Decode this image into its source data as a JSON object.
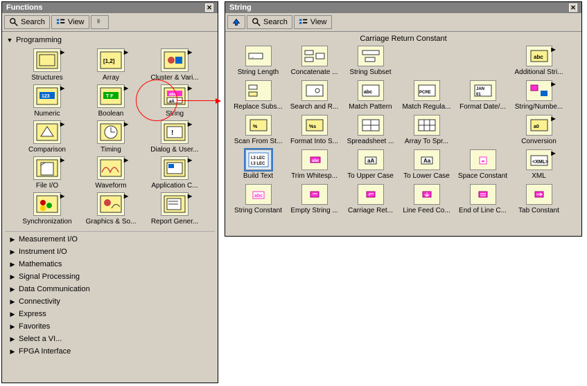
{
  "functions": {
    "title": "Functions",
    "close_glyph": "✕",
    "toolbar": {
      "search_label": "Search",
      "view_label": "View",
      "pin_label": ""
    },
    "programming_label": "Programming",
    "programming_items": [
      {
        "label": "Structures",
        "sub": true
      },
      {
        "label": "Array",
        "sub": true
      },
      {
        "label": "Cluster & Vari...",
        "sub": true
      },
      {
        "label": "Numeric",
        "sub": true
      },
      {
        "label": "Boolean",
        "sub": true
      },
      {
        "label": "String",
        "sub": true
      },
      {
        "label": "Comparison",
        "sub": true
      },
      {
        "label": "Timing",
        "sub": true
      },
      {
        "label": "Dialog & User...",
        "sub": true
      },
      {
        "label": "File I/O",
        "sub": true
      },
      {
        "label": "Waveform",
        "sub": true
      },
      {
        "label": "Application C...",
        "sub": true
      },
      {
        "label": "Synchronization",
        "sub": true
      },
      {
        "label": "Graphics & So...",
        "sub": true
      },
      {
        "label": "Report Gener...",
        "sub": true
      }
    ],
    "categories": [
      "Measurement I/O",
      "Instrument I/O",
      "Mathematics",
      "Signal Processing",
      "Data Communication",
      "Connectivity",
      "Express",
      "Favorites",
      "Select a VI...",
      "FPGA Interface"
    ]
  },
  "string": {
    "title": "String",
    "close_glyph": "✕",
    "toolbar": {
      "up_label": "",
      "search_label": "Search",
      "view_label": "View"
    },
    "header": "Carriage Return Constant",
    "items": [
      {
        "label": "String Length",
        "sub": false,
        "icon": "slen"
      },
      {
        "label": "Concatenate ...",
        "sub": false,
        "icon": "concat"
      },
      {
        "label": "String Subset",
        "sub": false,
        "icon": "subset"
      },
      {
        "label": "",
        "sub": false,
        "icon": "blank"
      },
      {
        "label": "",
        "sub": false,
        "icon": "blank"
      },
      {
        "label": "Additional Stri...",
        "sub": true,
        "icon": "addl"
      },
      {
        "label": "Replace Subs...",
        "sub": false,
        "icon": "replace"
      },
      {
        "label": "Search and R...",
        "sub": false,
        "icon": "searchr"
      },
      {
        "label": "Match Pattern",
        "sub": false,
        "icon": "match"
      },
      {
        "label": "Match Regula...",
        "sub": false,
        "icon": "regex"
      },
      {
        "label": "Format Date/...",
        "sub": false,
        "icon": "fdate"
      },
      {
        "label": "String/Numbe...",
        "sub": true,
        "icon": "strnum"
      },
      {
        "label": "Scan From St...",
        "sub": false,
        "icon": "scan"
      },
      {
        "label": "Format Into S...",
        "sub": false,
        "icon": "fmt"
      },
      {
        "label": "Spreadsheet ...",
        "sub": false,
        "icon": "ss1"
      },
      {
        "label": "Array To Spr...",
        "sub": false,
        "icon": "ss2"
      },
      {
        "label": "",
        "sub": false,
        "icon": "blank"
      },
      {
        "label": "Conversion",
        "sub": true,
        "icon": "conv"
      },
      {
        "label": "Build Text",
        "sub": false,
        "icon": "build",
        "selected": true
      },
      {
        "label": "Trim Whitesp...",
        "sub": false,
        "icon": "trim"
      },
      {
        "label": "To Upper Case",
        "sub": false,
        "icon": "upper"
      },
      {
        "label": "To Lower Case",
        "sub": false,
        "icon": "lower"
      },
      {
        "label": "Space Constant",
        "sub": false,
        "icon": "space"
      },
      {
        "label": "XML",
        "sub": true,
        "icon": "xml"
      },
      {
        "label": "String Constant",
        "sub": false,
        "icon": "sconst"
      },
      {
        "label": "Empty String ...",
        "sub": false,
        "icon": "empty"
      },
      {
        "label": "Carriage Ret...",
        "sub": false,
        "icon": "cr"
      },
      {
        "label": "Line Feed Co...",
        "sub": false,
        "icon": "lf"
      },
      {
        "label": "End of Line C...",
        "sub": false,
        "icon": "eol"
      },
      {
        "label": "Tab Constant",
        "sub": false,
        "icon": "tab"
      }
    ]
  },
  "colors": {
    "panel_bg": "#d6cfc4",
    "title_bg": "#808080",
    "highlight": "#3c7cc4",
    "annotation": "#ff0000",
    "pink": "#ff2fd1"
  }
}
